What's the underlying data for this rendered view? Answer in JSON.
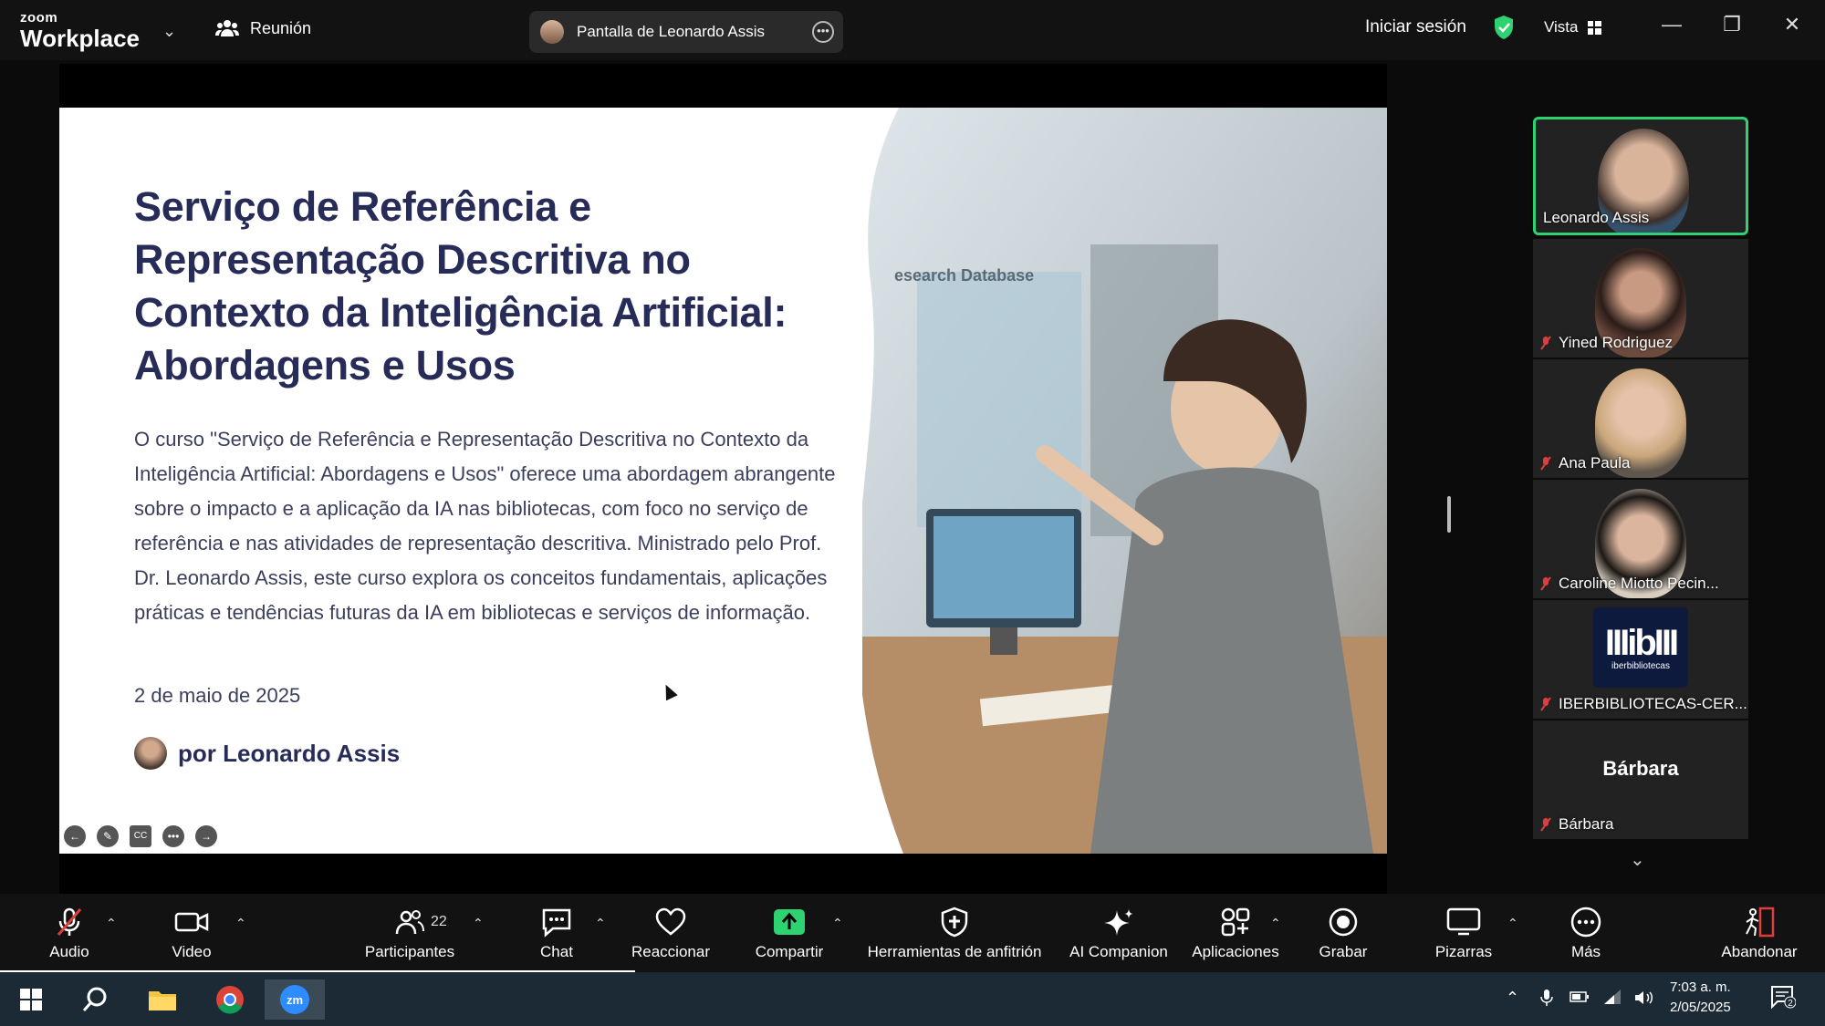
{
  "titlebar": {
    "logo_top": "zoom",
    "logo_bottom": "Workplace",
    "meeting_label": "Reunión",
    "share_label": "Pantalla de Leonardo Assis",
    "signin_label": "Iniciar sesión",
    "view_label": "Vista"
  },
  "slide": {
    "title": "Serviço de Referência e Representação Descritiva no Contexto da Inteligência Artificial: Abordagens e Usos",
    "body": "O curso \"Serviço de Referência e Representação Descritiva no Contexto da Inteligência Artificial: Abordagens e Usos\" oferece uma abordagem abrangente sobre o impacto e a aplicação da IA nas bibliotecas, com foco no serviço de referência e nas atividades de representação descritiva. Ministrado pelo Prof. Dr. Leonardo Assis, este curso explora os conceitos fundamentais, aplicações práticas e tendências futuras da IA em bibliotecas e serviços de informação.",
    "date": "2 de maio de 2025",
    "author": "por Leonardo Assis",
    "photo_text": "esearch Database"
  },
  "participants": [
    {
      "name": "Leonardo Assis"
    },
    {
      "name": "Yined Rodriguez"
    },
    {
      "name": "Ana Paula"
    },
    {
      "name": "Caroline Miotto Pecin..."
    },
    {
      "name": "IBERBIBLIOTECAS-CER...",
      "logo_text": "IIIibIII",
      "logo_sub": "iberbibliotecas"
    },
    {
      "name": "Bárbara",
      "display": "Bárbara"
    }
  ],
  "toolbar": {
    "audio": "Audio",
    "video": "Video",
    "participants": "Participantes",
    "participants_count": "22",
    "chat": "Chat",
    "react": "Reaccionar",
    "share": "Compartir",
    "host_tools": "Herramientas de anfitrión",
    "ai": "AI Companion",
    "apps": "Aplicaciones",
    "record": "Grabar",
    "whiteboards": "Pizarras",
    "more": "Más",
    "leave": "Abandonar"
  },
  "taskbar": {
    "time": "7:03 a. m.",
    "date": "2/05/2025",
    "notifications": "2"
  },
  "colors": {
    "accent_green": "#2fd271",
    "title_navy": "#262b58",
    "leave_red": "#e03e3e"
  }
}
